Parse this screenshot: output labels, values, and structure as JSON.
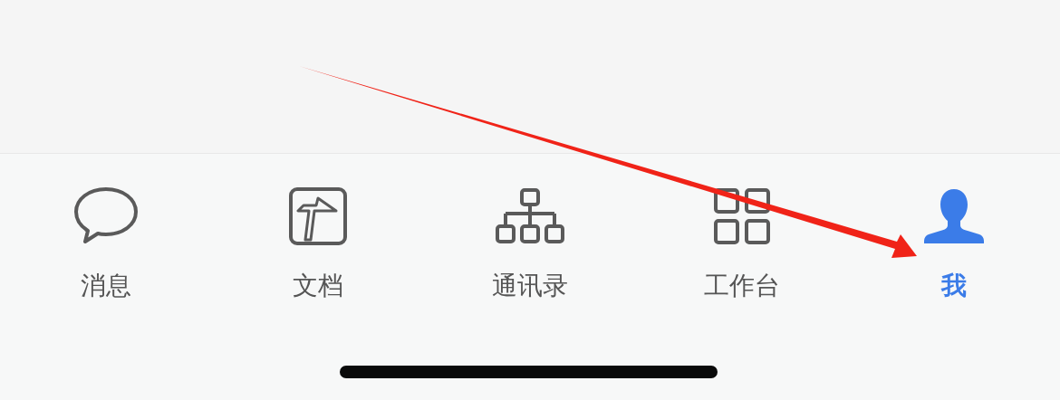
{
  "tab_bar": {
    "tabs": [
      {
        "label": "消息",
        "kind": "chat",
        "selected": false
      },
      {
        "label": "文档",
        "kind": "document",
        "selected": false
      },
      {
        "label": "通讯录",
        "kind": "contacts",
        "selected": false
      },
      {
        "label": "工作台",
        "kind": "workspace",
        "selected": false
      },
      {
        "label": "我",
        "kind": "profile",
        "selected": true
      }
    ]
  }
}
